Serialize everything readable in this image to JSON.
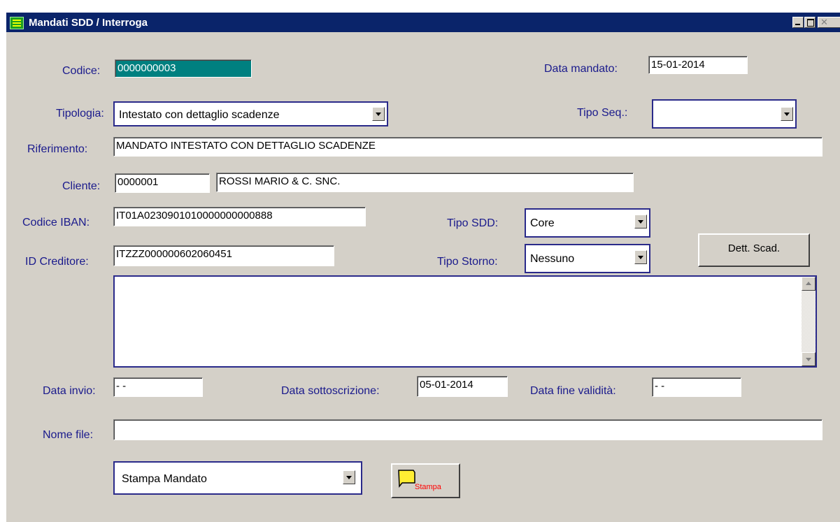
{
  "window": {
    "title": "Mandati SDD / Interroga"
  },
  "form": {
    "codice": {
      "label": "Codice:",
      "value": "0000000003"
    },
    "data_mandato": {
      "label": "Data mandato:",
      "value": "15-01-2014"
    },
    "tipologia": {
      "label": "Tipologia:",
      "value": "Intestato con dettaglio scadenze"
    },
    "tipo_seq": {
      "label": "Tipo Seq.:",
      "value": ""
    },
    "riferimento": {
      "label": "Riferimento:",
      "value": "MANDATO INTESTATO CON DETTAGLIO SCADENZE"
    },
    "cliente": {
      "label": "Cliente:",
      "code": "0000001",
      "name": "ROSSI MARIO & C. SNC."
    },
    "codice_iban": {
      "label": "Codice IBAN:",
      "value": "IT01A0230901010000000000888"
    },
    "tipo_sdd": {
      "label": "Tipo SDD:",
      "value": "Core"
    },
    "id_creditore": {
      "label": "ID Creditore:",
      "value": "ITZZZ000000602060451"
    },
    "tipo_storno": {
      "label": "Tipo Storno:",
      "value": "Nessuno"
    },
    "dett_scad_button": "Dett. Scad.",
    "data_invio": {
      "label": "Data invio:",
      "value": "- -"
    },
    "data_sottoscrizione": {
      "label": "Data sottoscrizione:",
      "value": "05-01-2014"
    },
    "data_fine_validita": {
      "label": "Data fine validità:",
      "value": "- -"
    },
    "nome_file": {
      "label": "Nome file:",
      "value": ""
    },
    "stampa_select": "Stampa Mandato",
    "stampa_button": "Stampa"
  }
}
